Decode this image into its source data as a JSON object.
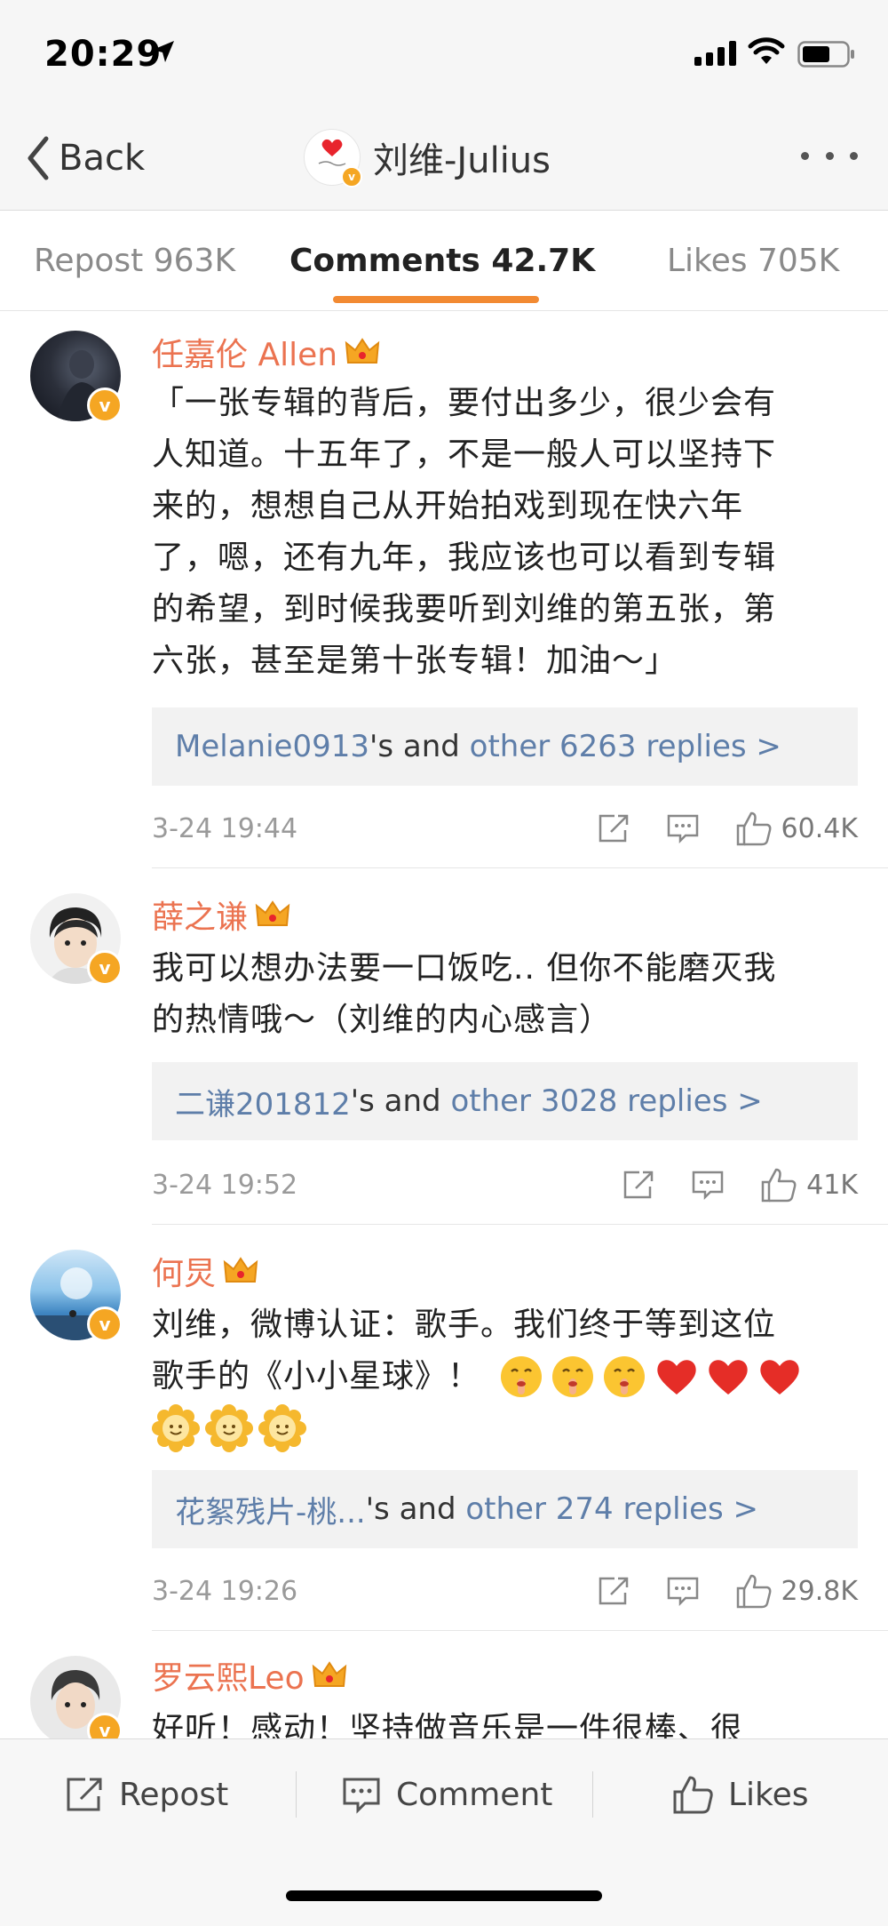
{
  "status": {
    "time": "20:29"
  },
  "nav": {
    "back_label": "Back",
    "title": "刘维-Julius"
  },
  "tabs": [
    {
      "label": "Repost 963K"
    },
    {
      "label": "Comments 42.7K"
    },
    {
      "label": "Likes 705K"
    }
  ],
  "comments": [
    {
      "user": "任嘉伦 Allen",
      "lines": [
        "「一张专辑的背后，要付出多少，很少会有",
        "人知道。十五年了，不是一般人可以坚持下",
        "来的，想想自己从开始拍戏到现在快六年",
        "了，嗯，还有九年，我应该也可以看到专辑",
        "的希望，到时候我要听到刘维的第五张，第",
        "六张，甚至是第十张专辑！加油～」"
      ],
      "reply_user": "Melanie0913",
      "reply_mid": "'s and ",
      "reply_more": "other 6263 replies >",
      "time": "3-24 19:44",
      "likes": "60.4K"
    },
    {
      "user": "薛之谦",
      "lines": [
        "我可以想办法要一口饭吃.. 但你不能磨灭我",
        "的热情哦～（刘维的内心感言）"
      ],
      "reply_user": "二谦201812",
      "reply_mid": "'s and ",
      "reply_more": "other 3028 replies >",
      "time": "3-24 19:52",
      "likes": "41K"
    },
    {
      "user": "何炅",
      "lines": [
        "刘维，微博认证：歌手。我们终于等到这位",
        "歌手的《小小星球》！"
      ],
      "reply_user": "花絮残片-桃...",
      "reply_mid": "'s and ",
      "reply_more": "other 274 replies >",
      "time": "3-24 19:26",
      "likes": "29.8K"
    },
    {
      "user": "罗云熙Leo",
      "lines": [
        "好听！感动！坚持做音乐是一件很棒、很"
      ]
    }
  ],
  "bottom": {
    "repost": "Repost",
    "comment": "Comment",
    "likes": "Likes"
  },
  "colors": {
    "accent": "#f28a32",
    "username": "#eb7350",
    "link": "#5e7ea9",
    "badge": "#f5a623"
  }
}
